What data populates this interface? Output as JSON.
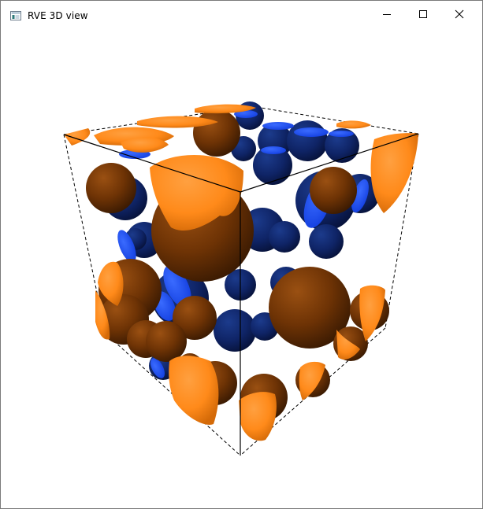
{
  "window": {
    "title": "RVE 3D view",
    "icon": "app-window-icon"
  },
  "caption_buttons": {
    "minimize": "minimize-icon",
    "maximize": "maximize-icon",
    "close": "close-icon"
  },
  "scene": {
    "description_shape": "voxel-cube-with-spherical-inclusions",
    "colors": {
      "background": "#ffffff",
      "phase_orange": "#ff8a1a",
      "phase_brown": "#7a3a06",
      "phase_dark_blue": "#0f2466",
      "phase_bright_blue": "#1a4cff",
      "edge_lines": "#000000"
    }
  }
}
